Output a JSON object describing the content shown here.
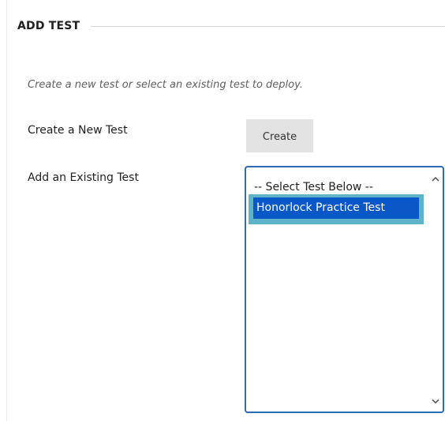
{
  "section": {
    "title": "ADD TEST"
  },
  "instructions": "Create a new test or select an existing test to deploy.",
  "create_row": {
    "label": "Create a New Test",
    "button_label": "Create"
  },
  "existing_row": {
    "label": "Add an Existing Test",
    "options": [
      "-- Select Test Below --",
      "Honorlock Practice Test"
    ],
    "selected_index": 1
  },
  "icons": {
    "scroll_up": "chevron-up-icon",
    "scroll_down": "chevron-down-icon"
  },
  "colors": {
    "listbox_border": "#2d6bb3",
    "selected_bg": "#0a58c8",
    "selected_focus": "#5fb3c8",
    "button_bg": "#e3e3e3"
  }
}
